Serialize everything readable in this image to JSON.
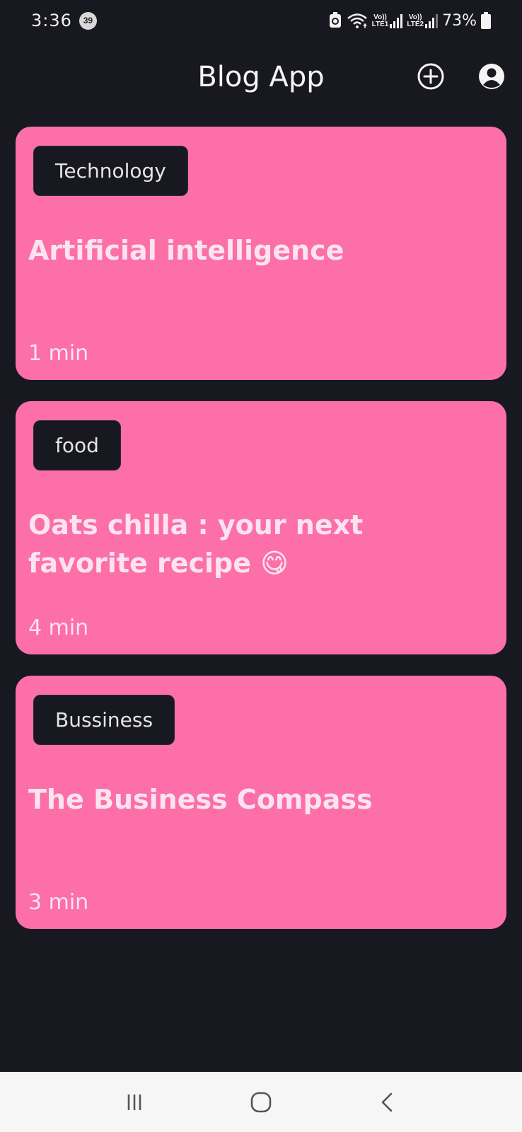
{
  "status_bar": {
    "time": "3:36",
    "notification_count": "39",
    "sim1_label_top": "Vo))",
    "sim1_label_bottom": "LTE1",
    "sim2_label_top": "Vo))",
    "sim2_label_bottom": "LTE2",
    "battery": "73%"
  },
  "app_bar": {
    "title": "Blog App",
    "add_icon": "plus-circle-icon",
    "profile_icon": "account-circle-icon"
  },
  "posts": [
    {
      "tag": "Technology",
      "title": "Artificial intelligence",
      "read_time": "1 min"
    },
    {
      "tag": "food",
      "title": "Oats chilla : your next favorite recipe 😋",
      "read_time": "4 min"
    },
    {
      "tag": "Bussiness",
      "title": "The Business Compass",
      "read_time": "3 min"
    }
  ],
  "nav_bar": {
    "recents_icon": "recents-icon",
    "home_icon": "home-icon",
    "back_icon": "back-icon"
  },
  "colors": {
    "background": "#181820",
    "card": "#fc6fa9",
    "card_text": "#fbe4ef",
    "chip": "#181820",
    "nav_bar": "#f6f6f6"
  }
}
